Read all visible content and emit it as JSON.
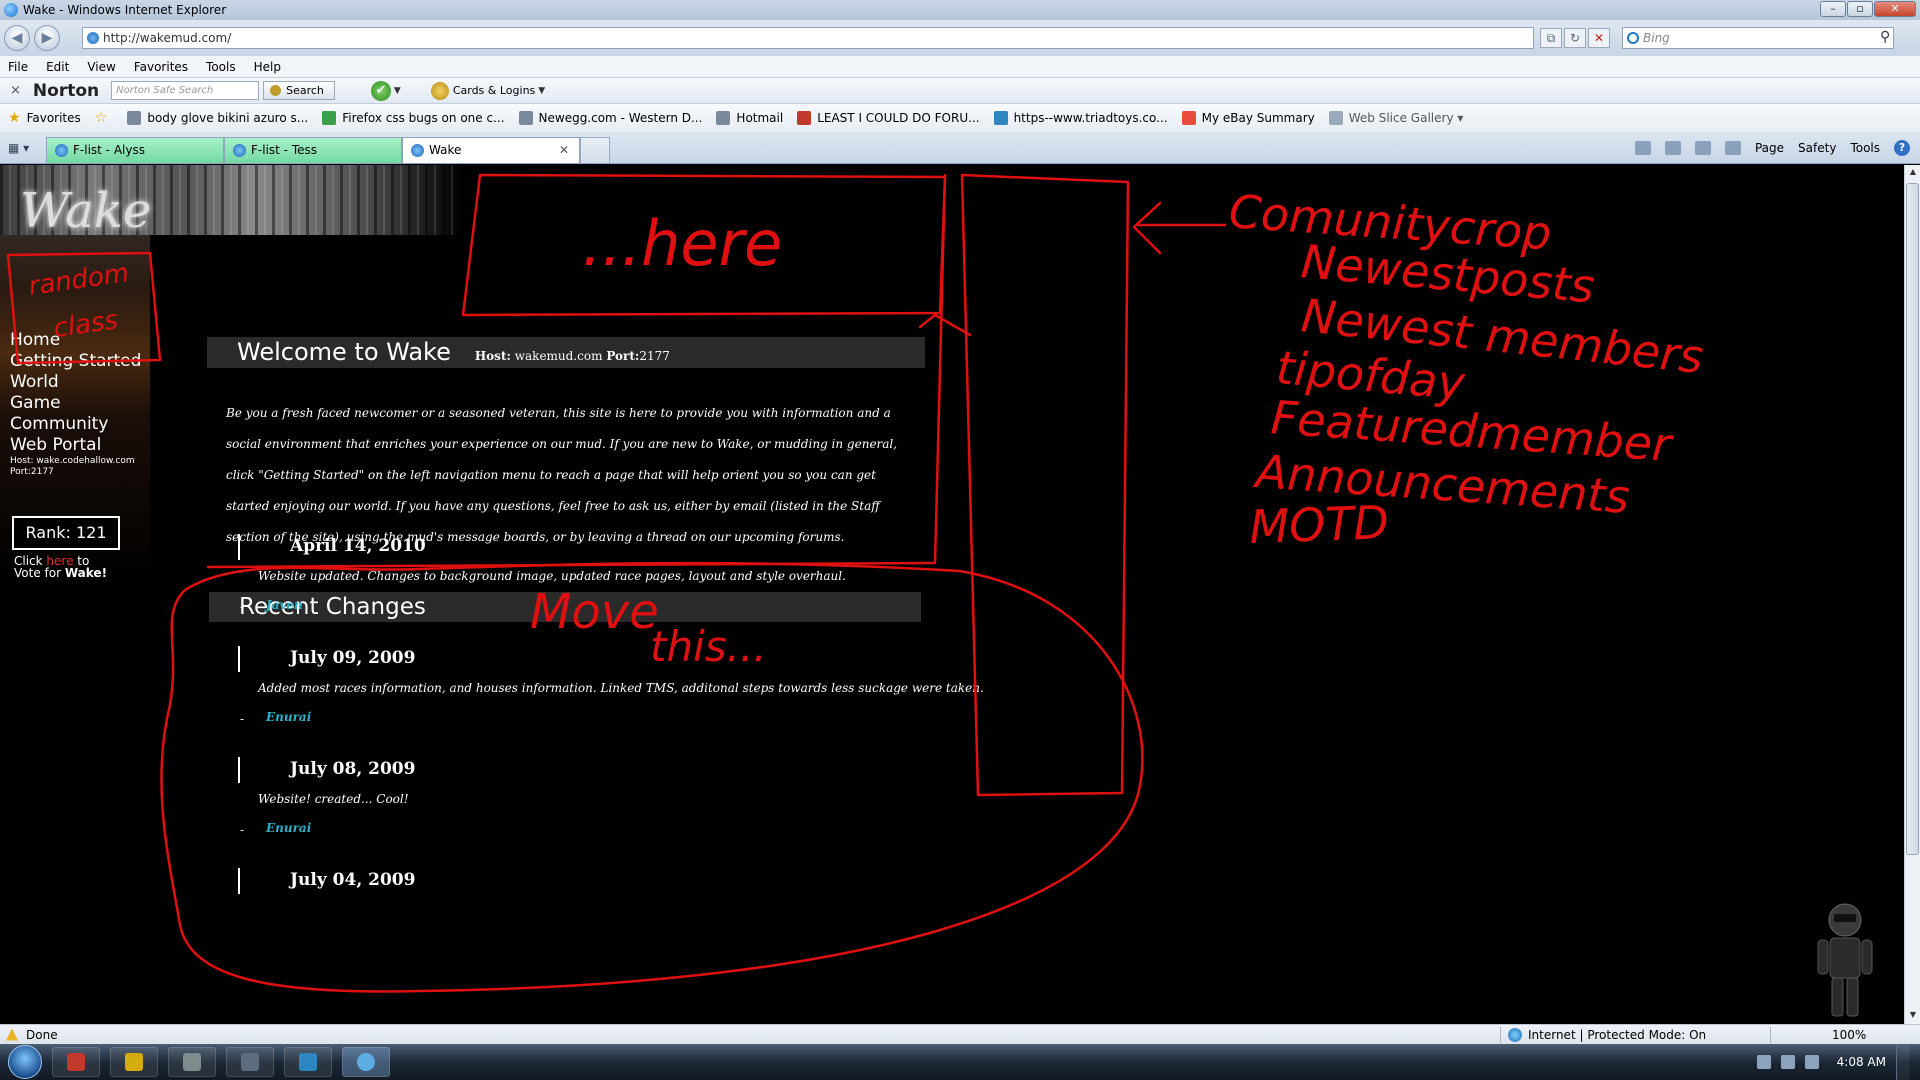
{
  "window": {
    "title": "Wake - Windows Internet Explorer",
    "controls": [
      "–",
      "▫",
      "✕"
    ]
  },
  "nav": {
    "url": "http://wakemud.com/",
    "search_placeholder": "Bing",
    "back_icon": "back-arrow-icon",
    "forward_icon": "forward-arrow-icon"
  },
  "menu": [
    "File",
    "Edit",
    "View",
    "Favorites",
    "Tools",
    "Help"
  ],
  "norton": {
    "close": "×",
    "brand": "Norton",
    "search_placeholder": "Norton Safe Search",
    "search_button": "Search",
    "cards": "Cards & Logins"
  },
  "favorites": {
    "label": "Favorites",
    "items": [
      {
        "label": "body glove bikini azuro s...",
        "color": "#7a8a9c"
      },
      {
        "label": "Firefox css bugs on one c...",
        "color": "#3aa04a"
      },
      {
        "label": "Newegg.com - Western D...",
        "color": "#7a8a9c"
      },
      {
        "label": "Hotmail",
        "color": "#7a8a9c"
      },
      {
        "label": "LEAST I COULD DO FORU...",
        "color": "#c0392b"
      },
      {
        "label": "https--www.triadtoys.co...",
        "color": "#2e86c1"
      },
      {
        "label": "My eBay Summary",
        "color": "#e74c3c"
      }
    ],
    "gallery": "Web Slice Gallery"
  },
  "tabs": [
    {
      "label": "F-list - Alyss",
      "style": "green"
    },
    {
      "label": "F-list - Tess",
      "style": "green"
    },
    {
      "label": "Wake",
      "style": "active"
    }
  ],
  "command_bar": {
    "page": "Page",
    "safety": "Safety",
    "tools": "Tools"
  },
  "site": {
    "logo": "Wake",
    "nav_items": [
      "Home",
      "Getting Started",
      "World",
      "Game",
      "Community",
      "Web Portal"
    ],
    "host_line": "Host: wake.codehallow.com",
    "port_line": "Port:2177",
    "rank": "Rank: 121",
    "vote_click": "Click",
    "vote_here": "here",
    "vote_to": "to",
    "vote_for": "Vote for",
    "vote_wake": "Wake!",
    "welcome_title": "Welcome to Wake",
    "welcome_host_label": "Host:",
    "welcome_host": "wakemud.com",
    "welcome_port_label": "Port:",
    "welcome_port": "2177",
    "welcome_text": "Be you a fresh faced newcomer or a seasoned veteran, this site is here to provide you with information and a social environment that enriches your experience on our mud. If you are new to Wake, or mudding in general, click \"Getting Started\" on the left navigation menu to reach a page that will help orient you so you can get started enjoying our world. If you have any questions, feel free to ask us, either by email (listed in the Staff section of the site), using the mud's message boards, or by leaving a thread on our upcoming forums.",
    "changes_title": "Recent Changes",
    "changes": [
      {
        "date": "April 14, 2010",
        "desc": "Website updated. Changes to background image, updated race pages, layout and style overhaul.",
        "author": "Javen"
      },
      {
        "date": "July 09, 2009",
        "desc": "Added most races information, and houses information. Linked TMS, additonal steps towards less suckage were taken.",
        "author": "Enurai"
      },
      {
        "date": "July 08, 2009",
        "desc": "Website! created... Cool!",
        "author": "Enurai"
      },
      {
        "date": "July 04, 2009",
        "desc": "",
        "author": ""
      }
    ]
  },
  "annotations": {
    "color": "#e01010",
    "random_class": [
      "random",
      "class"
    ],
    "here": "...here",
    "move_this": [
      "Move",
      "this..."
    ],
    "community_title": "Comunitycrop",
    "community_items": [
      "Newestposts",
      "Newest members",
      "tipofday",
      "Featuredmember",
      "Announcements",
      "MOTD"
    ]
  },
  "status": {
    "done": "Done",
    "zone": "Internet | Protected Mode: On",
    "zoom": "100%"
  },
  "taskbar": {
    "time": "4:08 AM"
  }
}
